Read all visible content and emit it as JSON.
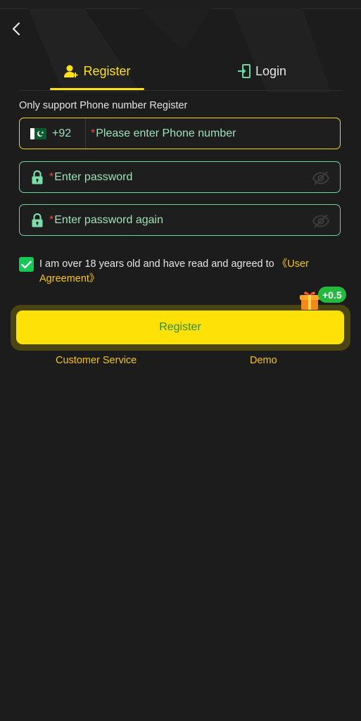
{
  "tabs": {
    "register": "Register",
    "login": "Login"
  },
  "form": {
    "support_note": "Only support Phone number Register",
    "country_code": "+92",
    "required_mark": "*",
    "phone_placeholder": "Please enter Phone number",
    "password_placeholder": "Enter password",
    "password_again_placeholder": "Enter password again"
  },
  "agreement": {
    "checked": true,
    "text": "I am over 18 years old and have read and agreed to ",
    "link": "《User Agreement》"
  },
  "register_button": {
    "label": "Register",
    "bonus": "+0.5"
  },
  "links": {
    "customer_service": "Customer Service",
    "demo": "Demo"
  },
  "icons": {
    "back": "chevron-left-icon",
    "register_tab": "add-user-icon",
    "login_tab": "login-door-icon",
    "country_flag": "pakistan-flag-icon",
    "lock": "lock-icon",
    "eye_off": "eye-off-icon",
    "check": "checkmark-icon",
    "gift": "gift-icon"
  },
  "colors": {
    "background": "#1c1c1c",
    "accent_yellow": "#fbe01a",
    "field_green": "#6fd3a0",
    "placeholder_green": "#9fe0b7",
    "required_red": "#e84a3b",
    "check_green": "#15c957"
  }
}
